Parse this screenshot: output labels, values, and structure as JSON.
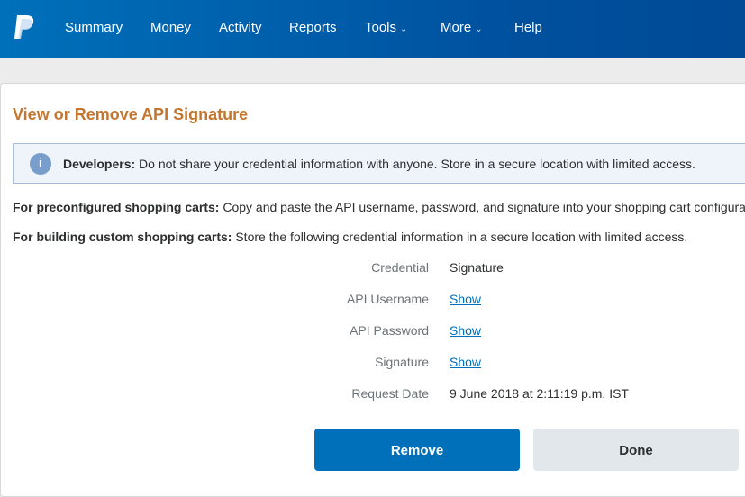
{
  "nav": {
    "items": [
      {
        "label": "Summary"
      },
      {
        "label": "Money"
      },
      {
        "label": "Activity"
      },
      {
        "label": "Reports"
      },
      {
        "label": "Tools",
        "dropdown": true
      },
      {
        "label": "More",
        "dropdown": true
      },
      {
        "label": "Help"
      }
    ],
    "chevron": "⌄"
  },
  "page": {
    "title": "View or Remove API Signature"
  },
  "notice": {
    "bold": "Developers:",
    "text": " Do not share your credential information with anyone. Store in a secure location with limited access.",
    "icon": "info-icon"
  },
  "paragraphs": [
    {
      "bold": "For preconfigured shopping carts:",
      "text": " Copy and paste the API username, password, and signature into your shopping cart configuration"
    },
    {
      "bold": "For building custom shopping carts:",
      "text": " Store the following credential information in a secure location with limited access."
    }
  ],
  "fields": [
    {
      "label": "Credential",
      "value": "Signature"
    },
    {
      "label": "API Username",
      "value": "Show"
    },
    {
      "label": "API Password",
      "value": "Show"
    },
    {
      "label": "Signature",
      "value": "Show"
    },
    {
      "label": "Request Date",
      "value": "9 June 2018 at 2:11:19 p.m. IST"
    }
  ],
  "buttons": {
    "remove": "Remove",
    "done": "Done"
  },
  "colors": {
    "brand": "#0070ba",
    "title": "#c4762f"
  }
}
